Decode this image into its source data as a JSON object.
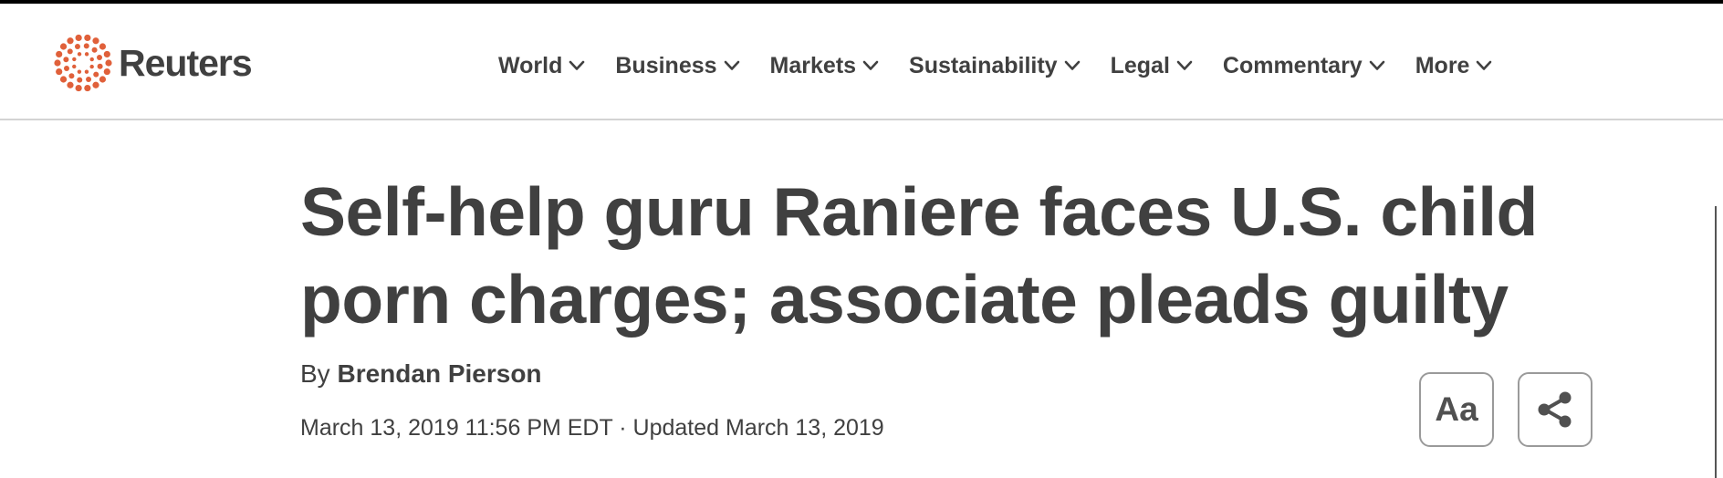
{
  "brand": {
    "name": "Reuters",
    "accent_color": "#e0603a",
    "icon": "reuters-logo-icon"
  },
  "nav": {
    "items": [
      {
        "label": "World",
        "icon": "chevron-down-icon"
      },
      {
        "label": "Business",
        "icon": "chevron-down-icon"
      },
      {
        "label": "Markets",
        "icon": "chevron-down-icon"
      },
      {
        "label": "Sustainability",
        "icon": "chevron-down-icon"
      },
      {
        "label": "Legal",
        "icon": "chevron-down-icon"
      },
      {
        "label": "Commentary",
        "icon": "chevron-down-icon"
      },
      {
        "label": "More",
        "icon": "chevron-down-icon"
      }
    ]
  },
  "article": {
    "headline_line1": "Self-help guru Raniere faces U.S. child",
    "headline_line2": "porn charges; associate pleads guilty",
    "byline_prefix": "By",
    "author": "Brendan Pierson",
    "dateline": "March 13, 2019 11:56 PM EDT · Updated March 13, 2019"
  },
  "tools": {
    "text_size_label": "Aa",
    "share_icon": "share-icon"
  }
}
